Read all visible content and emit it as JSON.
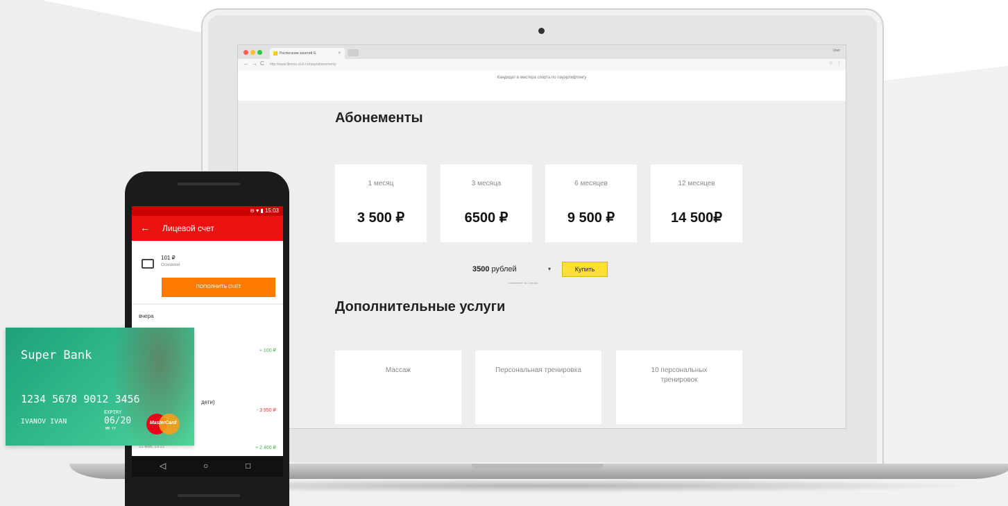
{
  "browser": {
    "tab_title": "Расписание занятий G",
    "tab_close": "×",
    "user": "User",
    "url": "http://www.fitness-club.ru/rasp/abonementy",
    "nav_back": "←",
    "nav_forward": "→",
    "nav_reload": "C",
    "star": "☆",
    "menu": "⋮"
  },
  "page": {
    "top_text": "Кандидат в мастера спорта по пауэрлифтингу",
    "subscriptions_title": "Абонементы",
    "subscriptions": [
      {
        "period": "1 месяц",
        "price": "3 500 ₽"
      },
      {
        "period": "3 месяца",
        "price": "6500 ₽"
      },
      {
        "period": "6 месяцев",
        "price": "9 500 ₽"
      },
      {
        "period": "12 месяцев",
        "price": "14 500₽"
      }
    ],
    "select": {
      "value_bold": "3500",
      "value_rest": " рублей",
      "arrow": "▾",
      "hint": "Абонемент на 1 месяц"
    },
    "buy_label": "Купить",
    "extra_title": "Дополнительные услуги",
    "services": [
      {
        "label": "Массаж"
      },
      {
        "label": "Персональная тренировка"
      },
      {
        "label": "10 персональных тренировок"
      }
    ]
  },
  "phone": {
    "status": "⊖ ▾ ▮ 15:03",
    "back": "←",
    "title": "Лицевой счет",
    "account_amount": "101 ₽",
    "account_type": "Основной",
    "topup_label": "ПОПОЛНИТЬ СЧЕТ",
    "day_label": "вчера",
    "tx1": "+ 100 ₽",
    "tx2_desc": "дети)",
    "tx2": "- 3 950 ₽",
    "tx3_date": "31 мая, 13:22",
    "tx3": "+ 2 400 ₽",
    "nav_back": "◁",
    "nav_home": "○",
    "nav_recent": "□"
  },
  "bank_card": {
    "bank_name": "Super Bank",
    "number": "1234 5678 9012 3456",
    "holder": "IVANOV IVAN",
    "expiry_label": "EXPIRY",
    "expiry": "06/20",
    "expiry_sub": "MM   YY",
    "brand": "MasterCard"
  }
}
